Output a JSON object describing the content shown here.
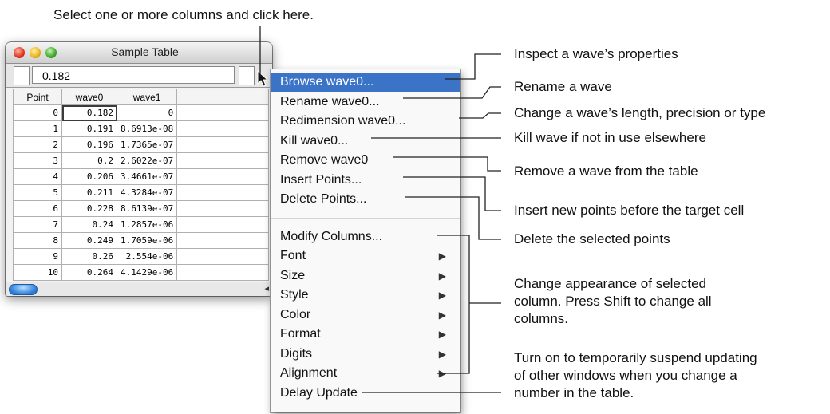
{
  "top_callout": "Select one or more columns and click here.",
  "window": {
    "title": "Sample Table",
    "entry_value": "0.182",
    "columns": [
      "Point",
      "wave0",
      "wave1"
    ],
    "rows": [
      [
        "0",
        "0.182",
        "0"
      ],
      [
        "1",
        "0.191",
        "8.6913e-08"
      ],
      [
        "2",
        "0.196",
        "1.7365e-07"
      ],
      [
        "3",
        "0.2",
        "2.6022e-07"
      ],
      [
        "4",
        "0.206",
        "3.4661e-07"
      ],
      [
        "5",
        "0.211",
        "4.3284e-07"
      ],
      [
        "6",
        "0.228",
        "8.6139e-07"
      ],
      [
        "7",
        "0.24",
        "1.2857e-06"
      ],
      [
        "8",
        "0.249",
        "1.7059e-06"
      ],
      [
        "9",
        "0.26",
        "2.554e-06"
      ],
      [
        "10",
        "0.264",
        "4.1429e-06"
      ]
    ]
  },
  "menu": {
    "items": [
      {
        "label": "Browse wave0...",
        "highlighted": true,
        "submenu": false
      },
      {
        "label": "Rename wave0...",
        "submenu": false
      },
      {
        "label": "Redimension wave0...",
        "submenu": false
      },
      {
        "label": "Kill wave0...",
        "submenu": false
      },
      {
        "label": "Remove wave0",
        "submenu": false
      },
      {
        "label": "Insert Points...",
        "submenu": false
      },
      {
        "label": "Delete Points...",
        "submenu": false
      },
      {
        "label": "Modify Columns...",
        "submenu": false
      },
      {
        "label": "Font",
        "submenu": true
      },
      {
        "label": "Size",
        "submenu": true
      },
      {
        "label": "Style",
        "submenu": true
      },
      {
        "label": "Color",
        "submenu": true
      },
      {
        "label": "Format",
        "submenu": true
      },
      {
        "label": "Digits",
        "submenu": true
      },
      {
        "label": "Alignment",
        "submenu": true
      },
      {
        "label": "Delay Update",
        "submenu": false
      }
    ]
  },
  "callouts": {
    "inspect": "Inspect a wave’s properties",
    "rename": "Rename a wave",
    "redimension": "Change a wave’s length, precision or type",
    "kill": "Kill wave if not in use elsewhere",
    "remove": "Remove a wave from the table",
    "insert": "Insert new points before the target cell",
    "delete": "Delete the selected points",
    "appearance": "Change appearance of selected column. Press Shift to change all columns.",
    "delay": "Turn on to temporarily suspend updating of other windows when you change a number in the table."
  },
  "colors": {
    "highlight": "#3b73c7",
    "menu_bg": "#f9f9f9"
  }
}
